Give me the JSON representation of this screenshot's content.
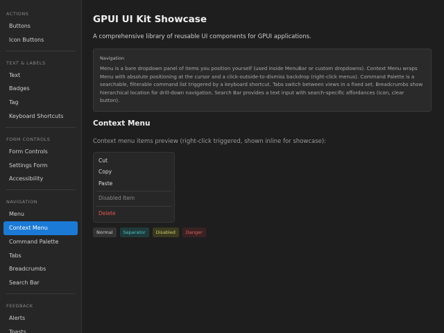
{
  "sidebar": {
    "sections": [
      {
        "title": "ACTIONS",
        "items": [
          "Buttons",
          "Icon Buttons"
        ]
      },
      {
        "title": "TEXT & LABELS",
        "items": [
          "Text",
          "Badges",
          "Tag",
          "Keyboard Shortcuts"
        ]
      },
      {
        "title": "FORM CONTROLS",
        "items": [
          "Form Controls",
          "Settings Form",
          "Accessibility"
        ]
      },
      {
        "title": "NAVIGATION",
        "items": [
          "Menu",
          "Context Menu",
          "Command Palette",
          "Tabs",
          "Breadcrumbs",
          "Search Bar"
        ]
      },
      {
        "title": "FEEDBACK",
        "items": [
          "Alerts",
          "Toasts"
        ]
      }
    ],
    "active_item": "Context Menu"
  },
  "main": {
    "title": "GPUI UI Kit Showcase",
    "subtitle": "A comprehensive library of reusable UI components for GPUI applications.",
    "info": {
      "title": "Navigation",
      "text": "Menu is a bare dropdown panel of items you position yourself (used inside MenuBar or custom dropdowns). Context Menu wraps Menu with absolute positioning at the cursor and a click-outside-to-dismiss backdrop (right-click menus). Command Palette is a searchable, filterable command list triggered by a keyboard shortcut. Tabs switch between views in a fixed set. Breadcrumbs show hierarchical location for drill-down navigation. Search Bar provides a text input with search-specific affordances (icon, clear button)."
    },
    "section_title": "Context Menu",
    "preview_label": "Context menu items preview (right-click triggered, shown inline for showcase):",
    "menu": {
      "cut": "Cut",
      "copy": "Copy",
      "paste": "Paste",
      "disabled_item": "Disabled Item",
      "delete": "Delete"
    },
    "badges": {
      "normal": "Normal",
      "separator": "Separator",
      "disabled": "Disabled",
      "danger": "Danger"
    }
  },
  "colors": {
    "accent": "#1b7ad6",
    "danger": "#e5534b",
    "background": "#1e1e1e"
  }
}
